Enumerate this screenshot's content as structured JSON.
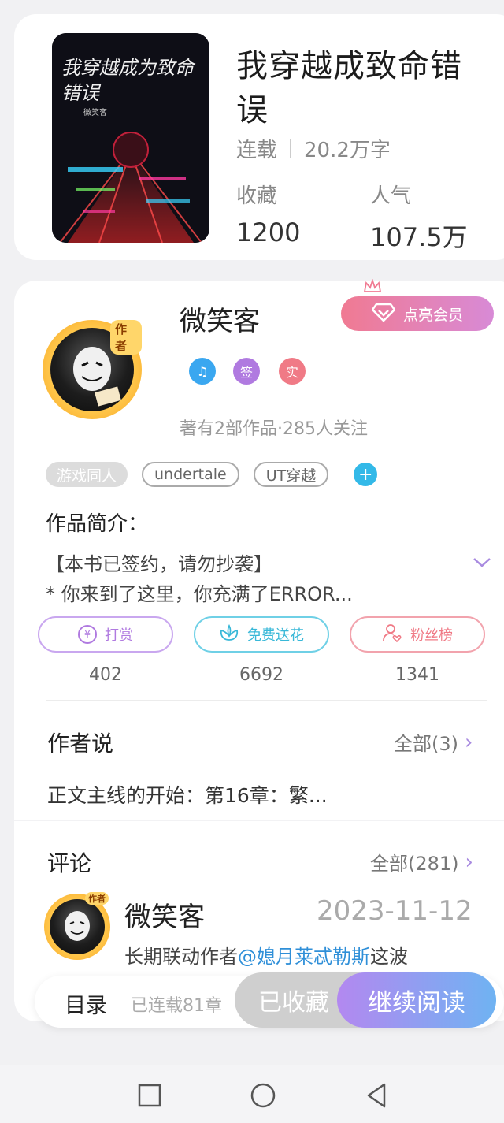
{
  "book": {
    "title": "我穿越成致命错误",
    "status": "连载",
    "word_count": "20.2万字",
    "favorites_label": "收藏",
    "favorites_value": "1200",
    "popularity_label": "人气",
    "popularity_value": "107.5万",
    "cover_title_text": "我穿越成为致命错误",
    "cover_author_text": "微笑客"
  },
  "author": {
    "name": "微笑客",
    "tag": "作者",
    "vip_button": "点亮会员",
    "badges": [
      {
        "icon": "music-badge-icon",
        "text": "♫",
        "color": "#3aa7f0"
      },
      {
        "icon": "signed-badge-icon",
        "text": "签",
        "color": "#b07ae0"
      },
      {
        "icon": "verified-badge-icon",
        "text": "实",
        "color": "#f07a86"
      }
    ],
    "stats": "著有2部作品·285人关注"
  },
  "tags": [
    "游戏同人",
    "undertale",
    "UT穿越"
  ],
  "intro": {
    "title": "作品简介：",
    "line1": "【本书已签约，请勿抄袭】",
    "line2": "* 你来到了这里，你充满了ERROR..."
  },
  "actions": [
    {
      "label": "打赏",
      "count": "402",
      "color": "#b07ae0"
    },
    {
      "label": "免费送花",
      "count": "6692",
      "color": "#38b8d8"
    },
    {
      "label": "粉丝榜",
      "count": "1341",
      "color": "#f07a86"
    }
  ],
  "author_says": {
    "title": "作者说",
    "more": "全部(3)",
    "text": "正文主线的开始：第16章：繁..."
  },
  "comments": {
    "title": "评论",
    "more": "全部(281)",
    "first": {
      "name": "微笑客",
      "date": "2023-11-12",
      "text_before": "长期联动作者",
      "mention": "@媳月莱忒勒斯",
      "text_after": "这波"
    }
  },
  "bottom_bar": {
    "toc": "目录",
    "serial": "已连载81章",
    "collected": "已收藏",
    "continue": "继续阅读"
  }
}
